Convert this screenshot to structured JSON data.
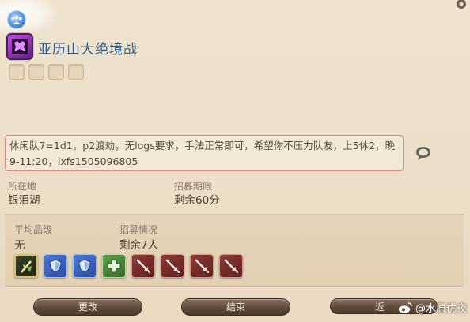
{
  "duty": {
    "name": "亚历山大绝境战"
  },
  "comment": "休闲队7=1d1，p2渡劫，无logs要求，手法正常即可，希望你不压力队友，上5休2，晚9-11:20，lxfs1505096805",
  "location": {
    "label": "所在地",
    "value": "银泪湖"
  },
  "deadline": {
    "label": "招募期限",
    "value": "剩余60分"
  },
  "avg_item_level": {
    "label": "平均品级",
    "value": "无"
  },
  "recruitment": {
    "label": "招募情况",
    "value": "剩余7人"
  },
  "party_slots": [
    {
      "role": "filled",
      "icon": "paladin-job-icon"
    },
    {
      "role": "tank",
      "icon": "tank-shield-icon"
    },
    {
      "role": "tank",
      "icon": "tank-shield-icon"
    },
    {
      "role": "healer",
      "icon": "healer-cross-icon"
    },
    {
      "role": "dps",
      "icon": "dps-sword-icon"
    },
    {
      "role": "dps",
      "icon": "dps-sword-icon"
    },
    {
      "role": "dps",
      "icon": "dps-sword-icon"
    },
    {
      "role": "dps",
      "icon": "dps-sword-icon"
    }
  ],
  "buttons": {
    "edit": "更改",
    "end": "结束",
    "back": "返"
  },
  "watermark": "@水原优夜",
  "colors": {
    "title": "#2f5a84",
    "comment_border": "#d98a7e",
    "tank": "#3e6cc9",
    "healer": "#4e8f3c",
    "dps": "#7a2f2c"
  }
}
